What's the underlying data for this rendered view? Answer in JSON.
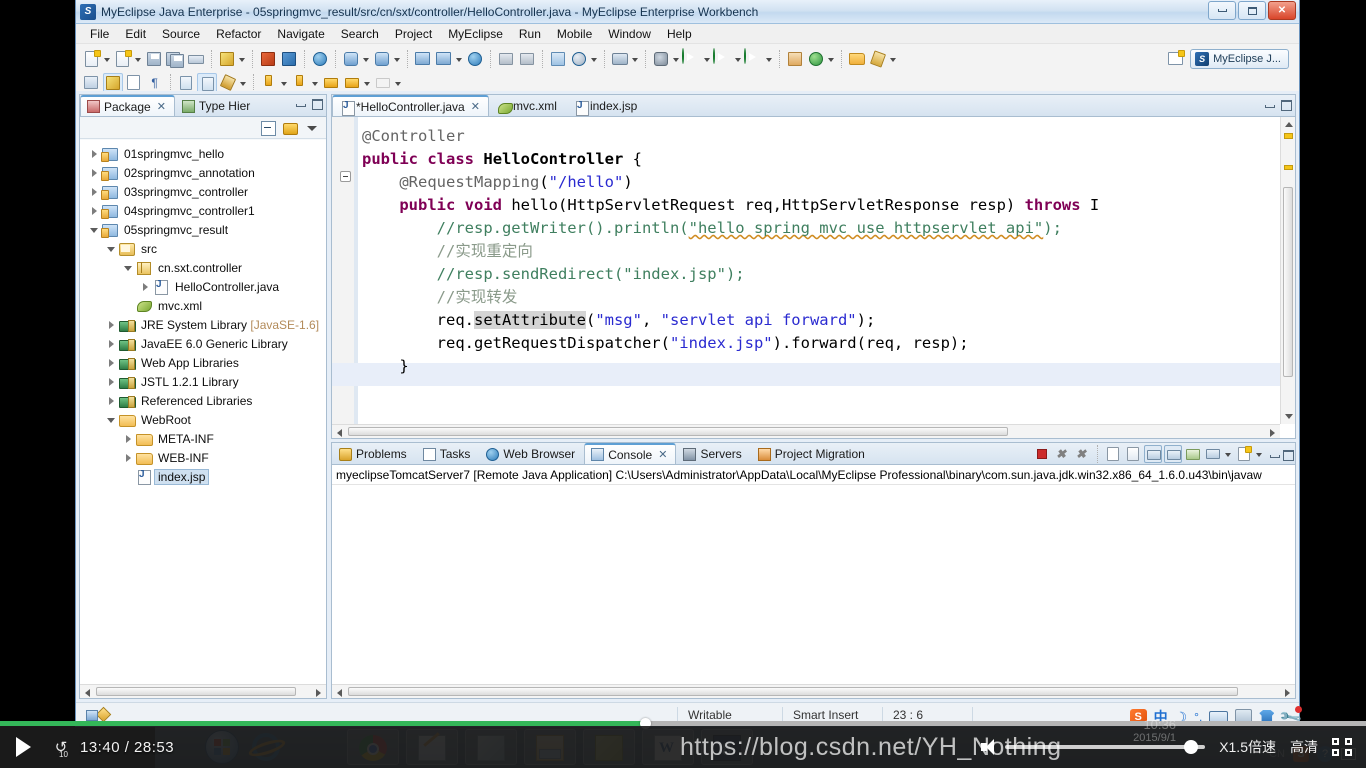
{
  "window": {
    "title": "MyEclipse Java Enterprise - 05springmvc_result/src/cn/sxt/controller/HelloController.java - MyEclipse Enterprise Workbench",
    "app_icon": "myeclipse-icon",
    "minimize_label": "Minimize",
    "maximize_label": "Restore",
    "close_label": "Close"
  },
  "menu": {
    "items": [
      "File",
      "Edit",
      "Source",
      "Refactor",
      "Navigate",
      "Search",
      "Project",
      "MyEclipse",
      "Run",
      "Mobile",
      "Window",
      "Help"
    ]
  },
  "toolbar": {
    "perspective_button": "MyEclipse J...",
    "open_perspective_tooltip": "Open Perspective"
  },
  "package_explorer": {
    "tabs": [
      {
        "label": "Package",
        "icon": "package-explorer-icon",
        "active": true,
        "closable": true
      },
      {
        "label": "Type Hier",
        "icon": "type-hierarchy-icon",
        "active": false,
        "closable": false
      }
    ],
    "view_actions": [
      "collapse-all-icon",
      "link-with-editor-icon",
      "view-menu-icon"
    ],
    "tree": [
      {
        "label": "01springmvc_hello",
        "icon": "java-project-icon",
        "indent": 0,
        "twisty": "closed"
      },
      {
        "label": "02springmvc_annotation",
        "icon": "java-project-icon",
        "indent": 0,
        "twisty": "closed"
      },
      {
        "label": "03springmvc_controller",
        "icon": "java-project-icon",
        "indent": 0,
        "twisty": "closed"
      },
      {
        "label": "04springmvc_controller1",
        "icon": "java-project-icon",
        "indent": 0,
        "twisty": "closed"
      },
      {
        "label": "05springmvc_result",
        "icon": "java-project-icon",
        "indent": 0,
        "twisty": "open"
      },
      {
        "label": "src",
        "icon": "source-folder-icon",
        "indent": 1,
        "twisty": "open"
      },
      {
        "label": "cn.sxt.controller",
        "icon": "package-icon",
        "indent": 2,
        "twisty": "open"
      },
      {
        "label": "HelloController.java",
        "icon": "java-file-icon",
        "indent": 3,
        "twisty": "closed"
      },
      {
        "label": "mvc.xml",
        "icon": "xml-file-icon",
        "indent": 2,
        "twisty": "none"
      },
      {
        "label": "JRE System Library",
        "suffix": " [JavaSE-1.6]",
        "icon": "library-icon",
        "indent": 1,
        "twisty": "closed"
      },
      {
        "label": "JavaEE 6.0 Generic Library",
        "icon": "library-icon",
        "indent": 1,
        "twisty": "closed"
      },
      {
        "label": "Web App Libraries",
        "icon": "library-icon",
        "indent": 1,
        "twisty": "closed"
      },
      {
        "label": "JSTL 1.2.1 Library",
        "icon": "library-icon",
        "indent": 1,
        "twisty": "closed"
      },
      {
        "label": "Referenced Libraries",
        "icon": "library-icon",
        "indent": 1,
        "twisty": "closed"
      },
      {
        "label": "WebRoot",
        "icon": "folder-icon",
        "indent": 1,
        "twisty": "open"
      },
      {
        "label": "META-INF",
        "icon": "folder-icon",
        "indent": 2,
        "twisty": "closed"
      },
      {
        "label": "WEB-INF",
        "icon": "folder-icon",
        "indent": 2,
        "twisty": "closed"
      },
      {
        "label": "index.jsp",
        "icon": "jsp-file-icon",
        "indent": 2,
        "twisty": "none",
        "selected": true
      }
    ]
  },
  "editor": {
    "tabs": [
      {
        "label": "*HelloController.java",
        "icon": "java-file-icon",
        "active": true,
        "closable": true,
        "dirty": true
      },
      {
        "label": "mvc.xml",
        "icon": "xml-file-icon",
        "active": false,
        "closable": false
      },
      {
        "label": "index.jsp",
        "icon": "jsp-file-icon",
        "active": false,
        "closable": false
      }
    ],
    "code_lines": [
      "Controller",
      "public class HelloController {",
      "    @RequestMapping(\"/hello\")",
      "    public void hello(HttpServletRequest req,HttpServletResponse resp) throws I",
      "        //resp.getWriter().println(\"hello spring mvc use httpservlet api\");",
      "        //实现重定向",
      "        //resp.sendRedirect(\"index.jsp\");",
      "        //实现转发",
      "        req.setAttribute(\"msg\", \"servlet api forward\");",
      "        req.getRequestDispatcher(\"index.jsp\").forward(req, resp);",
      "    }"
    ]
  },
  "console": {
    "tabs": [
      {
        "label": "Problems",
        "icon": "problems-icon",
        "active": false
      },
      {
        "label": "Tasks",
        "icon": "tasks-icon",
        "active": false
      },
      {
        "label": "Web Browser",
        "icon": "web-browser-icon",
        "active": false
      },
      {
        "label": "Console",
        "icon": "console-icon",
        "active": true,
        "closable": true
      },
      {
        "label": "Servers",
        "icon": "servers-icon",
        "active": false
      },
      {
        "label": "Project Migration",
        "icon": "project-migration-icon",
        "active": false
      }
    ],
    "toolbar_icons": [
      "terminate-icon",
      "remove-launch-icon",
      "remove-all-terminated-icon",
      "clear-console-icon",
      "scroll-lock-icon",
      "show-console-on-output-icon",
      "pin-console-icon",
      "display-selected-console-icon",
      "open-console-icon",
      "view-menu-icon",
      "minimize-icon",
      "maximize-icon"
    ],
    "header_text": "myeclipseTomcatServer7 [Remote Java Application] C:\\Users\\Administrator\\AppData\\Local\\MyEclipse Professional\\binary\\com.sun.java.jdk.win32.x86_64_1.6.0.u43\\bin\\javaw",
    "body_text": ""
  },
  "status_bar": {
    "writable": "Writable",
    "insert_mode": "Smart Insert",
    "cursor_position": "23 : 6"
  },
  "ime_tray": {
    "logo": "S",
    "language": "中",
    "mode_icon": "moon-icon",
    "punctuation_icon": "punctuation-icon",
    "keyboard_icon": "keyboard-icon",
    "toolbox_icon": "toolbox-icon",
    "skin_icon": "skin-icon",
    "settings_icon": "wrench-icon"
  },
  "player": {
    "play_icon": "play-icon",
    "replay_icon": "replay-10-icon",
    "time": "13:40 / 28:53",
    "progress_percent": 47.3,
    "volume_percent": 93,
    "speed_label": "X1.5倍速",
    "quality_label": "高清",
    "fullscreen_icon": "fullscreen-icon",
    "watermark": "https://blog.csdn.net/YH_Nothing",
    "ghost_clock": "10:36",
    "ghost_date": "2015/9/1"
  },
  "taskbar": {
    "start_icon": "windows-start-icon",
    "quick_launch": [
      "internet-explorer-icon"
    ],
    "apps": [
      "chrome-icon",
      "notepad-icon",
      "book-icon",
      "explorer-icon",
      "sticky-notes-icon",
      "word-icon",
      "photoshop-icon"
    ],
    "tray": [
      "ime-cn-icon",
      "sogou-icon",
      "help-icon",
      "network-icon",
      "volume-icon"
    ]
  },
  "colors": {
    "accent": "#5e9fd4",
    "progress": "#34b759",
    "keyword": "#9b0e6e",
    "string": "#2a2ad0",
    "comment": "#3f7f5f",
    "window_chrome": "#d8e6f2"
  }
}
